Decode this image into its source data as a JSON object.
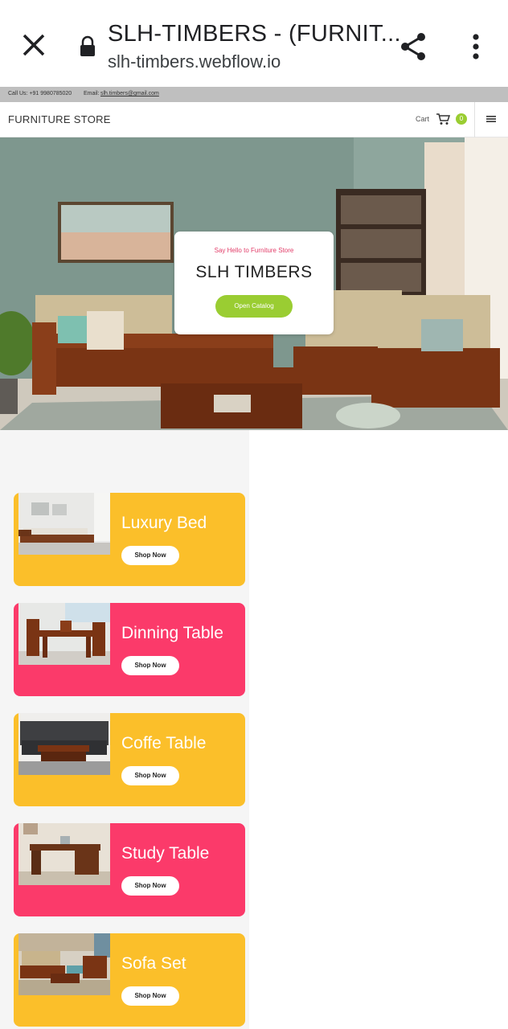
{
  "browser": {
    "title": "SLH-TIMBERS - (FURNIT...",
    "url": "slh-timbers.webflow.io",
    "icons": [
      "close-icon",
      "lock-icon",
      "share-icon",
      "more-vert-icon"
    ]
  },
  "topbar": {
    "call_label": "Call Us: +91 9980785020",
    "email_prefix": "Email:",
    "email": "slh.timbers@gmail.com"
  },
  "nav": {
    "brand": "FURNITURE STORE",
    "cart_label": "Cart",
    "cart_count": "0",
    "icons": [
      "cart-icon",
      "hamburger-menu-icon"
    ]
  },
  "hero": {
    "tagline": "Say Hello to Furniture Store",
    "heading": "SLH TIMBERS",
    "button": "Open Catalog"
  },
  "products": [
    {
      "name": "Luxury Bed",
      "button": "Shop Now",
      "color": "#fbbf2a"
    },
    {
      "name": "Dinning Table",
      "button": "Shop Now",
      "color": "#fb3a6a"
    },
    {
      "name": "Coffe Table",
      "button": "Shop Now",
      "color": "#fbbf2a"
    },
    {
      "name": "Study Table",
      "button": "Shop Now",
      "color": "#fb3a6a"
    },
    {
      "name": "Sofa Set",
      "button": "Shop Now",
      "color": "#fbbf2a"
    }
  ],
  "colors": {
    "accent_green": "#9acd32",
    "accent_pink": "#e23c68",
    "card_yellow": "#fbbf2a",
    "card_pink": "#fb3a6a"
  }
}
